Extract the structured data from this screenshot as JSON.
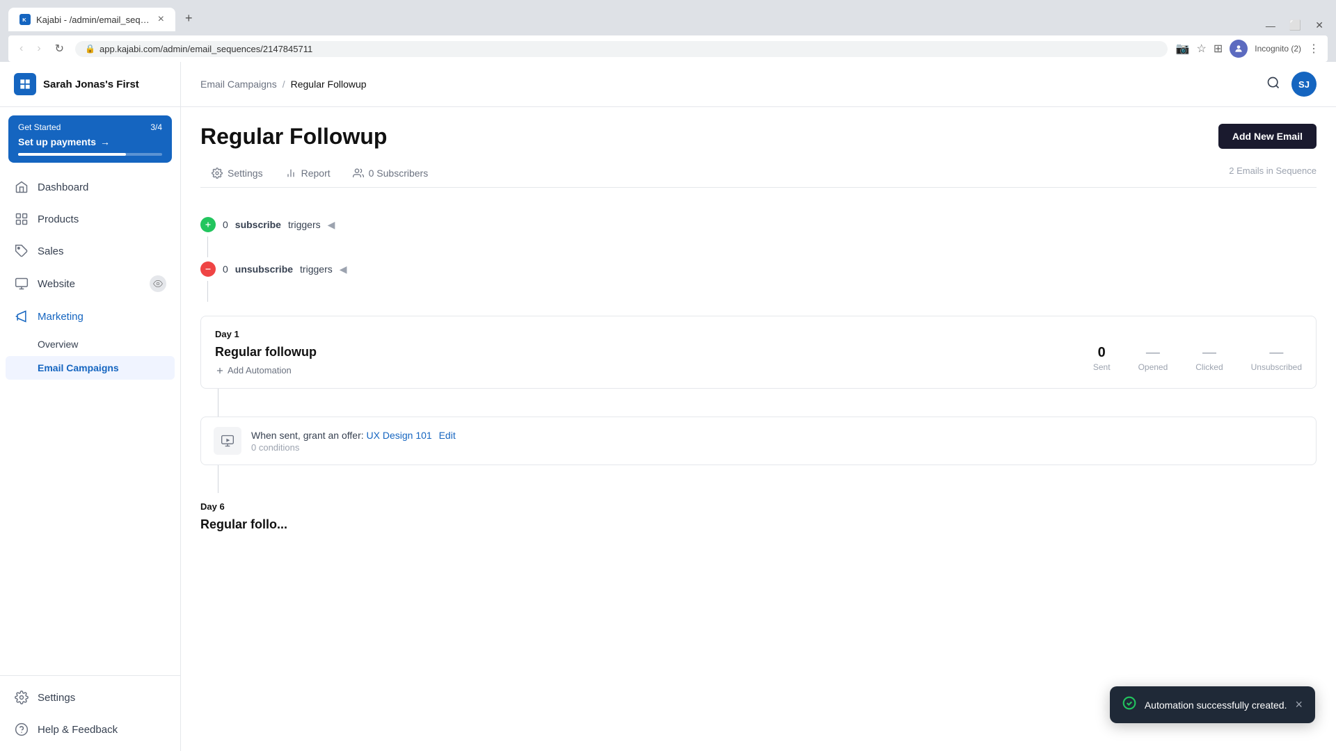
{
  "browser": {
    "tab_title": "Kajabi - /admin/email_sequences...",
    "tab_icon": "K",
    "url": "app.kajabi.com/admin/email_sequences/2147845711",
    "incognito_label": "Incognito (2)",
    "nav_back": "‹",
    "nav_forward": "›",
    "nav_reload": "↻"
  },
  "sidebar": {
    "brand_name": "Sarah Jonas's First",
    "setup_banner": {
      "label": "Get Started",
      "progress": "3/4",
      "title": "Set up payments",
      "arrow": "→"
    },
    "nav_items": [
      {
        "id": "dashboard",
        "label": "Dashboard",
        "icon": "home"
      },
      {
        "id": "products",
        "label": "Products",
        "icon": "grid"
      },
      {
        "id": "sales",
        "label": "Sales",
        "icon": "tag"
      },
      {
        "id": "website",
        "label": "Website",
        "icon": "monitor",
        "has_eye": true
      },
      {
        "id": "marketing",
        "label": "Marketing",
        "icon": "megaphone",
        "active": true
      }
    ],
    "sub_items": [
      {
        "id": "overview",
        "label": "Overview"
      },
      {
        "id": "email-campaigns",
        "label": "Email Campaigns",
        "active": true
      }
    ],
    "bottom_items": [
      {
        "id": "settings",
        "label": "Settings",
        "icon": "settings"
      },
      {
        "id": "help",
        "label": "Help & Feedback",
        "icon": "help-circle"
      }
    ]
  },
  "header": {
    "breadcrumb_parent": "Email Campaigns",
    "breadcrumb_sep": "/",
    "breadcrumb_current": "Regular Followup",
    "search_icon": "search",
    "avatar_initials": "SJ"
  },
  "page": {
    "title": "Regular Followup",
    "add_email_btn": "Add New Email",
    "emails_in_sequence": "2 Emails in Sequence",
    "tabs": [
      {
        "id": "settings",
        "label": "Settings",
        "icon": "settings"
      },
      {
        "id": "report",
        "label": "Report",
        "icon": "bar-chart"
      },
      {
        "id": "subscribers",
        "label": "0 Subscribers",
        "icon": "users"
      }
    ]
  },
  "triggers": {
    "subscribe_count": "0",
    "subscribe_label": "subscribe",
    "subscribe_suffix": "triggers",
    "unsubscribe_count": "0",
    "unsubscribe_label": "unsubscribe",
    "unsubscribe_suffix": "triggers"
  },
  "email_day1": {
    "day_label": "Day",
    "day_number": "1",
    "email_name": "Regular followup",
    "add_automation_label": "Add Automation",
    "stats": {
      "sent_value": "0",
      "sent_label": "Sent",
      "opened_label": "Opened",
      "clicked_label": "Clicked",
      "unsubscribed_label": "Unsubscribed"
    },
    "automation": {
      "when_text": "When sent, grant an offer:",
      "offer_name": "UX Design 101",
      "edit_label": "Edit",
      "conditions": "0 conditions"
    }
  },
  "email_day6": {
    "day_label": "Day",
    "day_number": "6",
    "email_name": "Regular follo..."
  },
  "toast": {
    "message": "Automation successfully created.",
    "check": "✓",
    "close": "×"
  }
}
